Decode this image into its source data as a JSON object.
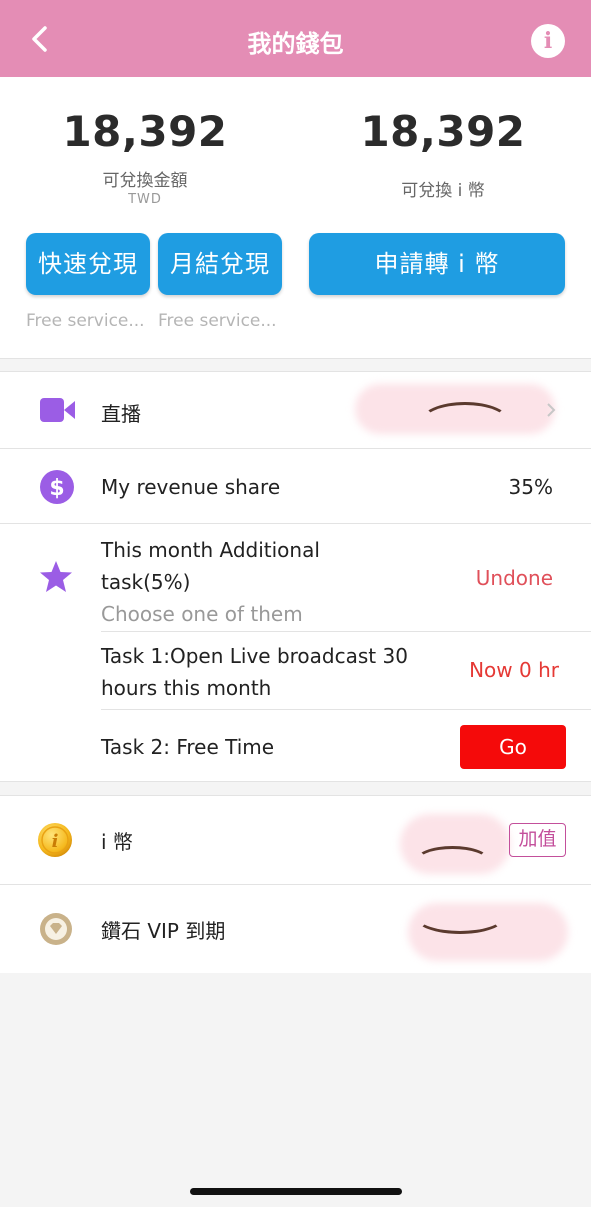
{
  "header": {
    "title": "我的錢包",
    "back_icon": "chevron-left-icon",
    "info_label": "i",
    "bg_color": "#e48db5"
  },
  "balances": {
    "cash": {
      "amount": "18,392",
      "label": "可兌換金額",
      "currency": "TWD"
    },
    "coins": {
      "amount": "18,392",
      "label": "可兌換 i 幣"
    }
  },
  "buttons": {
    "quick_redeem": "快速兌現",
    "monthly_redeem": "月結兌現",
    "convert_coins": "申請轉 i 幣",
    "color": "#1f9de2"
  },
  "notes": {
    "quick_note": "Free service...",
    "monthly_note": "Free service..."
  },
  "rows": {
    "live": {
      "label": "直播",
      "icon": "video-camera-icon"
    },
    "revenue": {
      "label": "My revenue share",
      "value": "35%",
      "icon": "dollar-circle-icon"
    },
    "task": {
      "title_line1": "This month Additional",
      "title_line2": "task(5%)",
      "subtitle": "Choose one of them",
      "status": "Undone",
      "icon": "star-icon"
    },
    "task1": {
      "line1": "Task 1:Open Live broadcast 30",
      "line2": "hours this month",
      "status": "Now 0 hr"
    },
    "task2": {
      "label": "Task 2: Free Time",
      "button": "Go"
    },
    "coin": {
      "label": "i 幣",
      "action": "加值",
      "icon": "coin-icon"
    },
    "vip": {
      "label": "鑽石 VIP 到期",
      "icon": "diamond-badge-icon"
    }
  },
  "colors": {
    "accent_purple": "#9b5de5",
    "alert_red": "#e53935",
    "go_red": "#f50a0a"
  }
}
